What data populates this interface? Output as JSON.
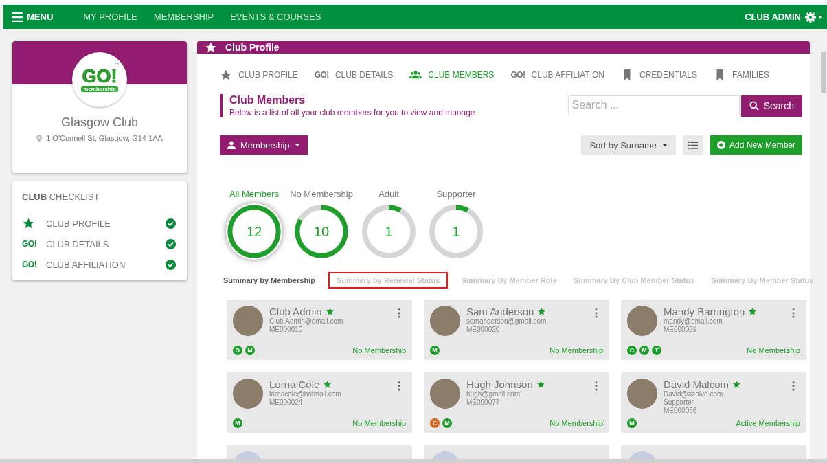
{
  "topbar": {
    "menu_label": "MENU",
    "nav": [
      {
        "label": "MY PROFILE"
      },
      {
        "label": "MEMBERSHIP"
      },
      {
        "label": "EVENTS & COURSES"
      }
    ],
    "user": "CLUB ADMIN"
  },
  "club": {
    "name": "Glasgow Club",
    "address": "1 O'Connell St, Glasgow, G14 1AA",
    "logo_word": "GO!",
    "logo_sub": "membership",
    "logo_tm": "™"
  },
  "checklist": {
    "title_bold": "CLUB",
    "title_rest": "CHECKLIST",
    "items": [
      {
        "kind": "star",
        "label": "CLUB PROFILE",
        "checked": true
      },
      {
        "kind": "go",
        "mark": "GO!",
        "label": "CLUB DETAILS",
        "checked": true
      },
      {
        "kind": "go",
        "mark": "GO!",
        "label": "CLUB AFFILIATION",
        "checked": true
      }
    ]
  },
  "panel": {
    "title": "Club Profile"
  },
  "tabs": [
    {
      "kind": "star",
      "label": "CLUB PROFILE",
      "selected": false
    },
    {
      "kind": "go",
      "mark": "GO!",
      "label": "CLUB DETAILS",
      "selected": false
    },
    {
      "kind": "people",
      "label": "CLUB MEMBERS",
      "selected": true
    },
    {
      "kind": "go",
      "mark": "GO!",
      "label": "CLUB AFFILIATION",
      "selected": false
    },
    {
      "kind": "bookmark",
      "label": "CREDENTIALS",
      "selected": false
    },
    {
      "kind": "bookmark",
      "label": "FAMILIES",
      "selected": false
    }
  ],
  "section": {
    "title": "Club Members",
    "subtitle": "Below is a list of all your club members for you to view and manage"
  },
  "search": {
    "placeholder": "Search ...",
    "button": "Search"
  },
  "filter_button": "Membership",
  "sort_button": "Sort by Surname",
  "add_button": "Add New Member",
  "gauges": [
    {
      "label": "All Members",
      "value": "12",
      "level": 1,
      "selected": true
    },
    {
      "label": "No Membership",
      "value": "10",
      "level": 0.83,
      "selected": false
    },
    {
      "label": "Adult",
      "value": "1",
      "level": 0.08,
      "selected": false
    },
    {
      "label": "Supporter",
      "value": "1",
      "level": 0.08,
      "selected": false
    }
  ],
  "summary_tabs": [
    {
      "label": "Summary by Membership",
      "selected": true,
      "highlighted": false
    },
    {
      "label": "Summary by Renewal Status",
      "selected": false,
      "highlighted": true
    },
    {
      "label": "Summary By Member Role",
      "selected": false,
      "highlighted": false
    },
    {
      "label": "Summary By Club Member Status",
      "selected": false,
      "highlighted": false
    },
    {
      "label": "Summary By Member Status",
      "selected": false,
      "highlighted": false
    }
  ],
  "members": [
    {
      "name": "Club Admin",
      "email": "Club.Admin@email.com",
      "lines": [
        "ME000010"
      ],
      "status": "No Membership",
      "badges": [
        {
          "letter": "S",
          "color": "#1e9e2a"
        },
        {
          "letter": "M",
          "color": "#1e9e2a"
        }
      ]
    },
    {
      "name": "Sam Anderson",
      "email": "samanderson@gmail.com",
      "lines": [
        "ME000020"
      ],
      "status": "No Membership",
      "badges": [
        {
          "letter": "M",
          "color": "#1e9e2a"
        }
      ]
    },
    {
      "name": "Mandy Barrington",
      "email": "mandy@email.com",
      "lines": [
        "ME000029"
      ],
      "status": "No Membership",
      "badges": [
        {
          "letter": "C",
          "color": "#1e9e2a"
        },
        {
          "letter": "M",
          "color": "#1e9e2a"
        },
        {
          "letter": "T",
          "color": "#1e9e2a"
        }
      ]
    },
    {
      "name": "Lorna Cole",
      "email": "lornacole@hotmail.com",
      "lines": [
        "ME000024"
      ],
      "status": "No Membership",
      "badges": [
        {
          "letter": "M",
          "color": "#1e9e2a"
        }
      ]
    },
    {
      "name": "Hugh Johnson",
      "email": "hugh@gmail.com",
      "lines": [
        "ME000077"
      ],
      "status": "No Membership",
      "badges": [
        {
          "letter": "C",
          "color": "#d2691e"
        },
        {
          "letter": "M",
          "color": "#1e9e2a"
        }
      ]
    },
    {
      "name": "David Malcom",
      "email": "David@azolve.com",
      "lines": [
        "Supporter",
        "ME000066"
      ],
      "status": "Active Membership",
      "badges": [
        {
          "letter": "M",
          "color": "#1e9e2a"
        }
      ]
    }
  ]
}
